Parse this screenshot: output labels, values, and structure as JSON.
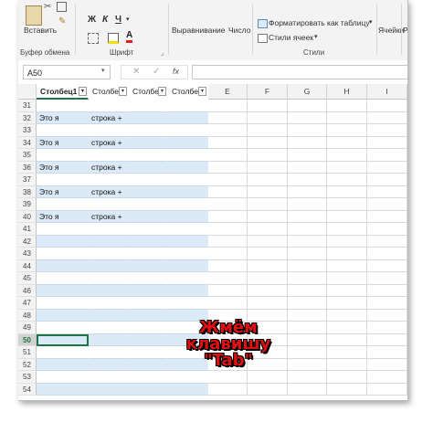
{
  "ribbon": {
    "paste_label": "Вставить",
    "bold": "Ж",
    "italic": "К",
    "underline": "Ч",
    "font_color_glyph": "А",
    "alignment_label": "Выравнивание",
    "number_label": "Число",
    "format_table_label": "Форматировать как таблицу",
    "cell_styles_label": "Стили ячеек",
    "cells_label": "Ячейки",
    "editing_label": "Р",
    "group_clipboard": "Буфер обмена",
    "group_font": "Шрифт",
    "group_styles": "Стили",
    "accent_color": "#217346"
  },
  "formula_bar": {
    "name_box": "A50",
    "formula": ""
  },
  "columns": {
    "table_headers": [
      "Столбец1",
      "Столбе",
      "Столбе",
      "Столбе"
    ],
    "plain": [
      "E",
      "F",
      "G",
      "H",
      "I"
    ]
  },
  "rows": [
    {
      "num": "31",
      "a": "",
      "b": ""
    },
    {
      "num": "32",
      "a": "Это я",
      "b": "строка +"
    },
    {
      "num": "33",
      "a": "",
      "b": ""
    },
    {
      "num": "34",
      "a": "Это я",
      "b": "строка +"
    },
    {
      "num": "35",
      "a": "",
      "b": ""
    },
    {
      "num": "36",
      "a": "Это я",
      "b": "строка +"
    },
    {
      "num": "37",
      "a": "",
      "b": ""
    },
    {
      "num": "38",
      "a": "Это я",
      "b": "строка +"
    },
    {
      "num": "39",
      "a": "",
      "b": ""
    },
    {
      "num": "40",
      "a": "Это я",
      "b": "строка +"
    },
    {
      "num": "41",
      "a": "",
      "b": ""
    },
    {
      "num": "42",
      "a": "",
      "b": ""
    },
    {
      "num": "43",
      "a": "",
      "b": ""
    },
    {
      "num": "44",
      "a": "",
      "b": ""
    },
    {
      "num": "45",
      "a": "",
      "b": ""
    },
    {
      "num": "46",
      "a": "",
      "b": ""
    },
    {
      "num": "47",
      "a": "",
      "b": ""
    },
    {
      "num": "48",
      "a": "",
      "b": ""
    },
    {
      "num": "49",
      "a": "",
      "b": ""
    },
    {
      "num": "50",
      "a": "",
      "b": ""
    },
    {
      "num": "51",
      "a": "",
      "b": ""
    },
    {
      "num": "52",
      "a": "",
      "b": ""
    },
    {
      "num": "53",
      "a": "",
      "b": ""
    },
    {
      "num": "54",
      "a": "",
      "b": ""
    }
  ],
  "active_row": "50",
  "overlay": {
    "line1": "Жмём",
    "line2": "клавишу",
    "line3": "\"Tab\""
  }
}
